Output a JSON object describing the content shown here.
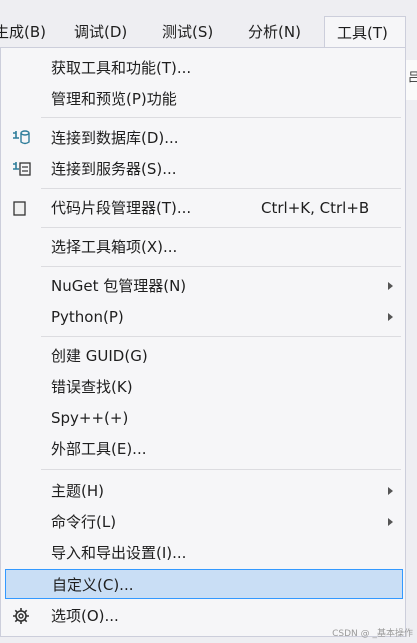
{
  "menubar": {
    "items": [
      {
        "label": "生成(B)"
      },
      {
        "label": "调试(D)"
      },
      {
        "label": "测试(S)"
      },
      {
        "label": "分析(N)"
      },
      {
        "label": "工具(T)"
      }
    ]
  },
  "right_strip": {
    "glyph": "吕"
  },
  "menu": {
    "items": [
      {
        "label": "获取工具和功能(T)..."
      },
      {
        "label": "管理和预览(P)功能"
      },
      {
        "label": "连接到数据库(D)...",
        "icon": "database-connect-icon"
      },
      {
        "label": "连接到服务器(S)...",
        "icon": "server-connect-icon"
      },
      {
        "label": "代码片段管理器(T)...",
        "icon": "snippet-icon",
        "shortcut": "Ctrl+K, Ctrl+B"
      },
      {
        "label": "选择工具箱项(X)..."
      },
      {
        "label": "NuGet 包管理器(N)",
        "submenu": true
      },
      {
        "label": "Python(P)",
        "submenu": true
      },
      {
        "label": "创建 GUID(G)"
      },
      {
        "label": "错误查找(K)"
      },
      {
        "label": "Spy++(+)"
      },
      {
        "label": "外部工具(E)..."
      },
      {
        "label": "主题(H)",
        "submenu": true
      },
      {
        "label": "命令行(L)",
        "submenu": true
      },
      {
        "label": "导入和导出设置(I)..."
      },
      {
        "label": "自定义(C)...",
        "selected": true
      },
      {
        "label": "选项(O)...",
        "icon": "gear-icon"
      }
    ]
  },
  "watermark": "CSDN @ _基本操作"
}
